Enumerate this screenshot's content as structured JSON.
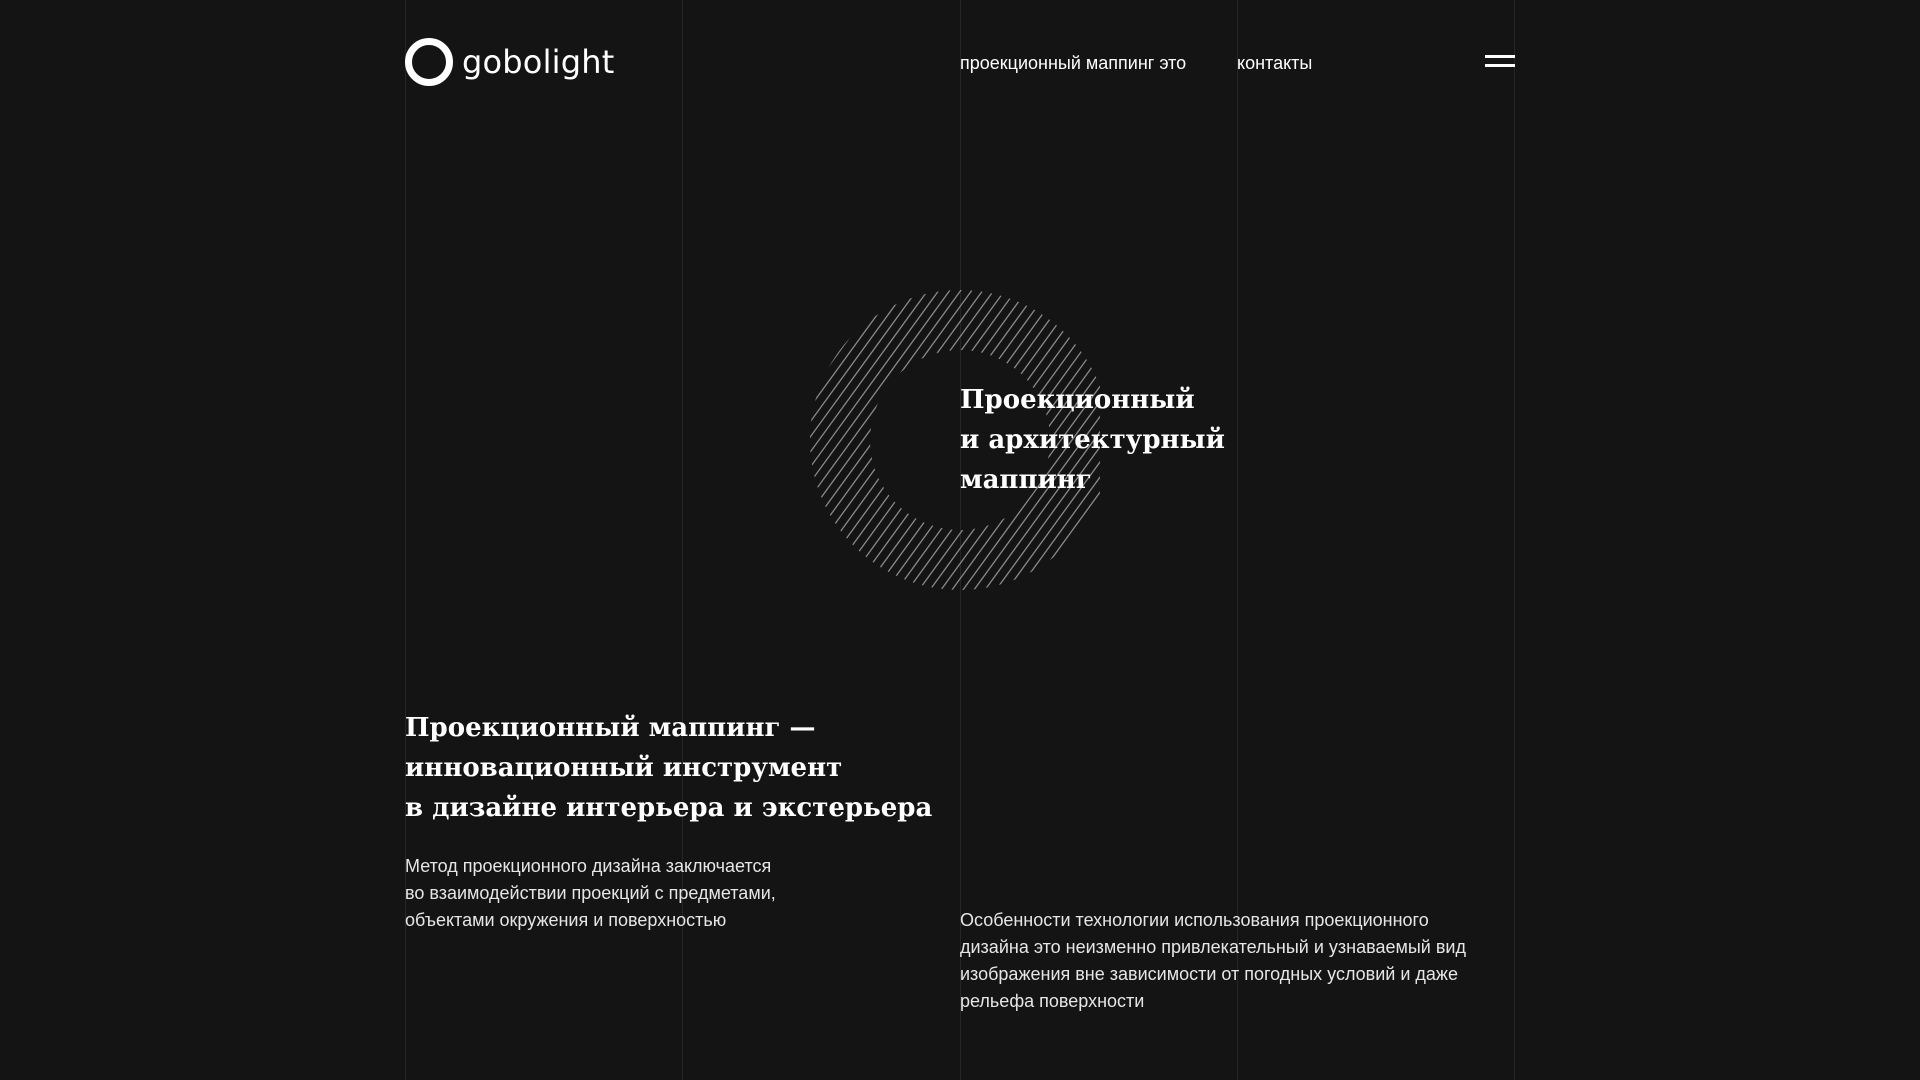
{
  "brand": {
    "name": "gobolight",
    "logo_icon": "ring-logo-icon"
  },
  "nav": {
    "links": [
      {
        "label": "проекционный маппинг это"
      },
      {
        "label": "контакты"
      }
    ],
    "menu_icon": "hamburger-menu-icon"
  },
  "hero": {
    "graphic_icon": "hatched-ring-graphic",
    "title": "Проекционный\nи архитектурный\nмаппинг"
  },
  "section": {
    "title": "Проекционный маппинг —\nинновационный инструмент\nв дизайне интерьера и экстерьера",
    "paragraph_left": "Метод проекционного дизайна заключается\nво взаимодействии проекций с предметами,\nобъектами окружения и поверхностью",
    "paragraph_right": "Особенности технологии использования проекционного\nдизайна это неизменно привлекательный и узнаваемый вид\nизображения вне зависимости от погодных условий и даже\nрельефа поверхности"
  },
  "colors": {
    "background": "#141414",
    "text": "#ffffff",
    "grid_line": "#262626",
    "hatch": "#8a8a8a"
  }
}
